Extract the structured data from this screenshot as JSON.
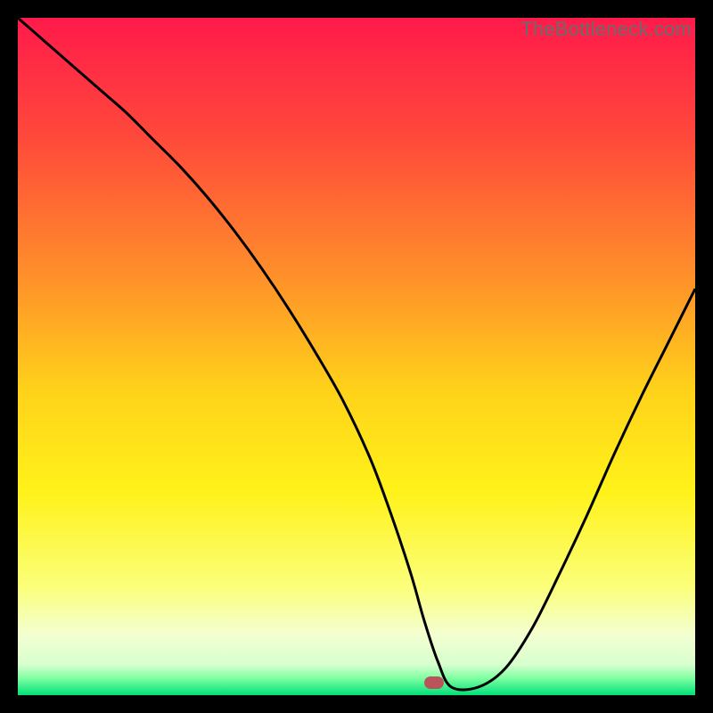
{
  "watermark": "TheBottleneck.com",
  "chart_data": {
    "type": "line",
    "title": "",
    "xlabel": "",
    "ylabel": "",
    "xlim": [
      0,
      100
    ],
    "ylim": [
      0,
      100
    ],
    "grid": false,
    "legend": false,
    "gradient_stops": [
      {
        "offset": 0.0,
        "color": "#ff1a4b"
      },
      {
        "offset": 0.18,
        "color": "#ff4a3a"
      },
      {
        "offset": 0.38,
        "color": "#ff8f2a"
      },
      {
        "offset": 0.55,
        "color": "#ffd21a"
      },
      {
        "offset": 0.7,
        "color": "#fff21a"
      },
      {
        "offset": 0.84,
        "color": "#fbff7a"
      },
      {
        "offset": 0.91,
        "color": "#f4ffd0"
      },
      {
        "offset": 0.955,
        "color": "#d8ffcf"
      },
      {
        "offset": 0.975,
        "color": "#7effa0"
      },
      {
        "offset": 1.0,
        "color": "#00e07a"
      }
    ],
    "series": [
      {
        "name": "bottleneck-curve",
        "color": "#000000",
        "stroke_width": 3,
        "x": [
          0,
          4,
          8,
          12,
          16,
          20,
          24,
          28,
          32,
          36,
          40,
          44,
          48,
          52,
          55,
          58,
          60,
          62,
          64,
          68,
          72,
          76,
          80,
          84,
          88,
          92,
          96,
          100
        ],
        "y": [
          100,
          96.5,
          93,
          89.5,
          86,
          82,
          78,
          73.5,
          68.5,
          63,
          57,
          50.5,
          43.5,
          35,
          27,
          18,
          11,
          5,
          1.2,
          1.2,
          4,
          10,
          18,
          26.5,
          35.5,
          44,
          52,
          60
        ]
      }
    ],
    "marker": {
      "name": "optimal-point",
      "x": 61.5,
      "y": 1.8,
      "color": "#b9555a"
    }
  }
}
